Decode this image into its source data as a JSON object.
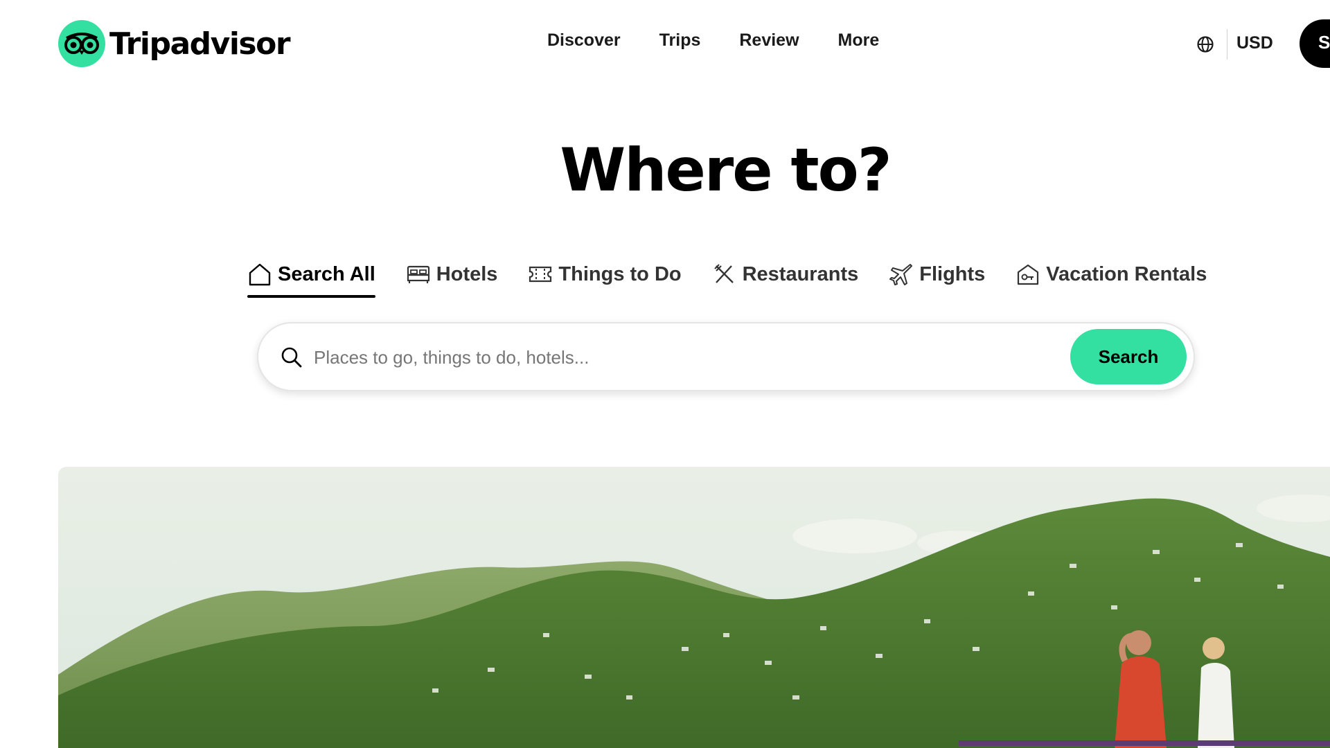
{
  "header": {
    "logo_text": "Tripadvisor",
    "nav": [
      "Discover",
      "Trips",
      "Review",
      "More"
    ],
    "currency": "USD",
    "signin_label": "S"
  },
  "headline": "Where to?",
  "tabs": [
    {
      "label": "Search All",
      "icon": "home-icon",
      "active": true
    },
    {
      "label": "Hotels",
      "icon": "bed-icon",
      "active": false
    },
    {
      "label": "Things to Do",
      "icon": "ticket-icon",
      "active": false
    },
    {
      "label": "Restaurants",
      "icon": "utensils-icon",
      "active": false
    },
    {
      "label": "Flights",
      "icon": "plane-icon",
      "active": false
    },
    {
      "label": "Vacation Rentals",
      "icon": "rental-house-icon",
      "active": false
    }
  ],
  "search": {
    "placeholder": "Places to go, things to do, hotels...",
    "button_label": "Search"
  },
  "colors": {
    "brand_green": "#34e0a1",
    "text": "#000000"
  }
}
